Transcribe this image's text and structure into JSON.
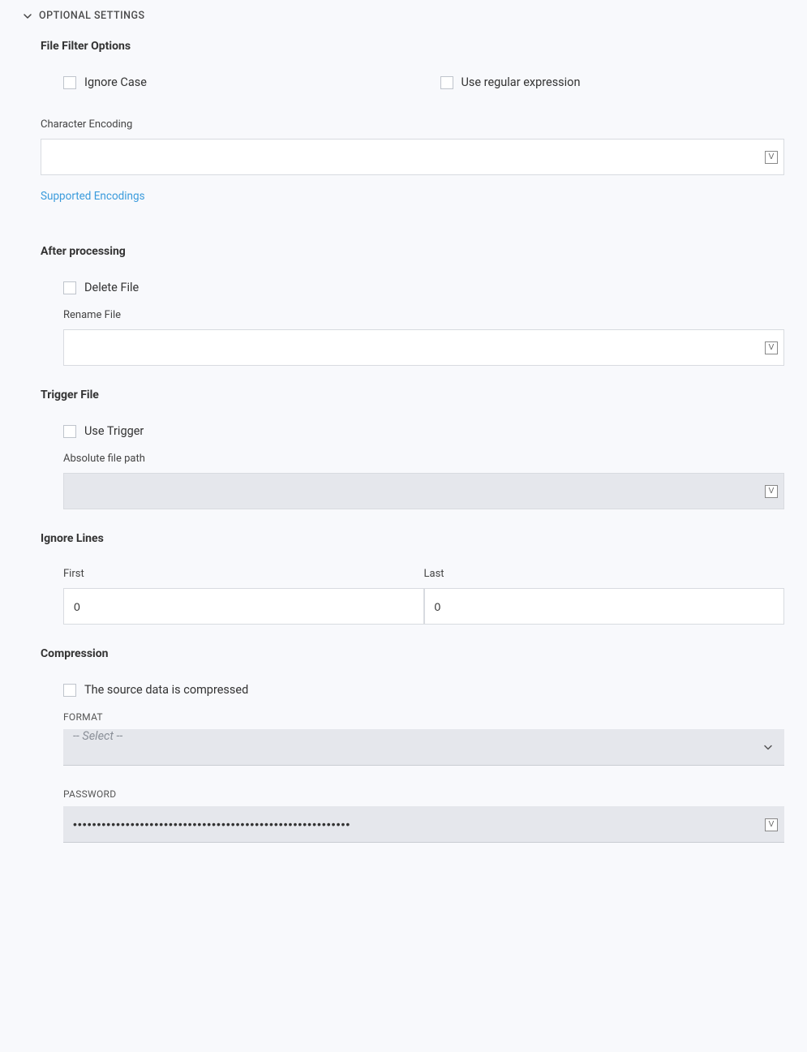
{
  "header": {
    "title": "OPTIONAL SETTINGS"
  },
  "file_filter": {
    "heading": "File Filter Options",
    "ignore_case_label": "Ignore Case",
    "use_regex_label": "Use regular expression",
    "char_encoding_label": "Character Encoding",
    "char_encoding_value": "",
    "supported_encodings_link": "Supported Encodings"
  },
  "after_processing": {
    "heading": "After processing",
    "delete_file_label": "Delete File",
    "rename_file_label": "Rename File",
    "rename_file_value": ""
  },
  "trigger_file": {
    "heading": "Trigger File",
    "use_trigger_label": "Use Trigger",
    "absolute_path_label": "Absolute file path",
    "absolute_path_value": ""
  },
  "ignore_lines": {
    "heading": "Ignore Lines",
    "first_label": "First",
    "first_value": "0",
    "last_label": "Last",
    "last_value": "0"
  },
  "compression": {
    "heading": "Compression",
    "compressed_label": "The source data is compressed",
    "format_label": "FORMAT",
    "format_placeholder": "-- Select --",
    "password_label": "PASSWORD",
    "password_value": "••••••••••••••••••••••••••••••••••••••••••••••••••••••••••"
  },
  "icons": {
    "v_glyph": "V"
  }
}
